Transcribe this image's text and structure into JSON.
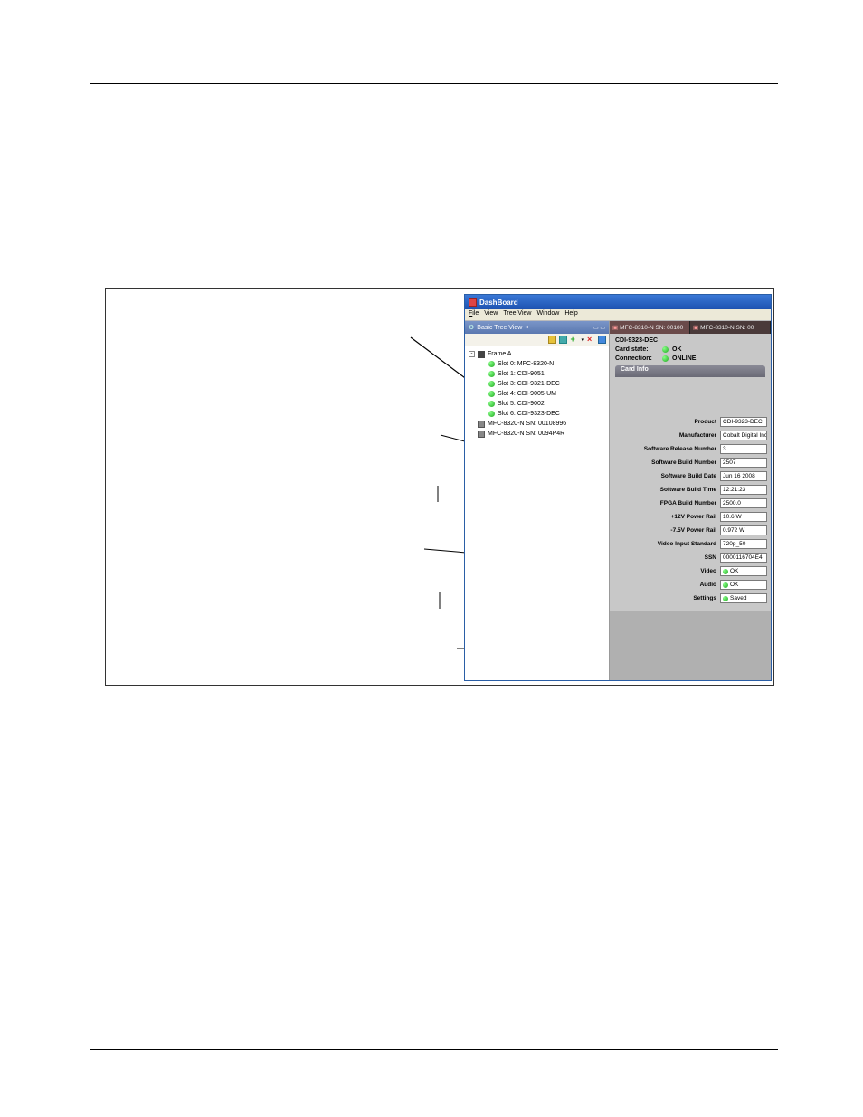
{
  "window": {
    "title": "DashBoard"
  },
  "menubar": {
    "file": "File",
    "view": "View",
    "treeview": "Tree View",
    "window": "Window",
    "help": "Help"
  },
  "treepanel": {
    "tab": "Basic Tree View",
    "tab_close": "×"
  },
  "tree": {
    "root": "Frame A",
    "slots": [
      "Slot 0: MFC-8320-N",
      "Slot 1: CDI-9051",
      "Slot 3: CDI-9321-DEC",
      "Slot 4: CDI-9005-UM",
      "Slot 5: CDI-9002",
      "Slot 6: CDI-9323-DEC"
    ],
    "extras": [
      "MFC-8320-N SN: 00108996",
      "MFC-8320-N SN: 0094P4R"
    ]
  },
  "tabs": {
    "active": "MFC-8310-N SN: 00100",
    "inactive": "MFC-8310-N SN: 00"
  },
  "card": {
    "name": "CDI-9323-DEC",
    "state_label": "Card state:",
    "state_value": "OK",
    "conn_label": "Connection:",
    "conn_value": "ONLINE",
    "info_header": "Card Info"
  },
  "fields": {
    "product": {
      "label": "Product",
      "value": "CDI-9323-DEC"
    },
    "manufacturer": {
      "label": "Manufacturer",
      "value": "Cobalt Digital Inc."
    },
    "srn": {
      "label": "Software Release Number",
      "value": "3"
    },
    "sbn": {
      "label": "Software Build Number",
      "value": "2507"
    },
    "sbd": {
      "label": "Software Build Date",
      "value": "Jun 16 2008"
    },
    "sbt": {
      "label": "Software Build Time",
      "value": "12:21:23"
    },
    "fpga": {
      "label": "FPGA Build Number",
      "value": "2500.0"
    },
    "p12v": {
      "label": "+12V Power Rail",
      "value": "10.6 W"
    },
    "p75v": {
      "label": "-7.5V Power Rail",
      "value": "0.972 W"
    },
    "vis": {
      "label": "Video Input Standard",
      "value": "720p_50"
    },
    "ssn": {
      "label": "SSN",
      "value": "0000116704E4"
    },
    "video": {
      "label": "Video",
      "value": "OK"
    },
    "audio": {
      "label": "Audio",
      "value": "OK"
    },
    "settings": {
      "label": "Settings",
      "value": "Saved"
    }
  }
}
